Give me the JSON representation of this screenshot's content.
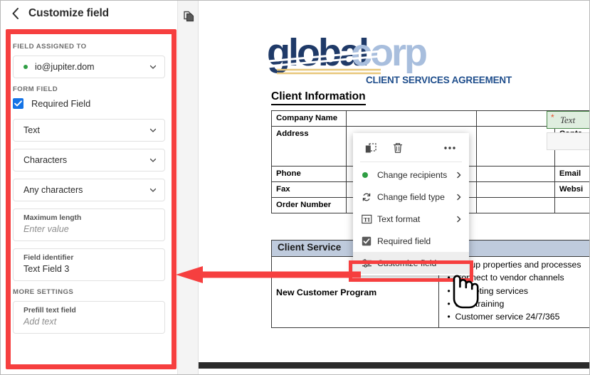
{
  "panel": {
    "title": "Customize field",
    "back_icon": "chevron-left-icon",
    "sections": {
      "assigned_label": "FIELD ASSIGNED TO",
      "assignee": "io@jupiter.dom",
      "assignee_status_color": "#2f9e44",
      "form_field_label": "FORM FIELD",
      "required_checkbox_label": "Required Field",
      "required_checked": true,
      "checkbox_color": "#1473e6",
      "type_select": "Text",
      "unit_select": "Characters",
      "charset_select": "Any characters",
      "max_length_label": "Maximum length",
      "max_length_placeholder": "Enter value",
      "identifier_label": "Field identifier",
      "identifier_value": "Text Field 3",
      "more_settings_label": "MORE SETTINGS",
      "prefill_label": "Prefill text field",
      "prefill_placeholder": "Add text"
    }
  },
  "toolbar": {
    "page_thumbnail_icon": "duplicate-page-icon"
  },
  "document": {
    "logo_text_dark": "global",
    "logo_text_light": "corp",
    "agreement_title": "CLIENT SERVICES AGREEMENT",
    "client_info_heading": "Client Information",
    "client_rows": [
      {
        "label": "Company Name",
        "right_label": ""
      },
      {
        "label": "Address",
        "right_label": "Conta"
      },
      {
        "label": "Phone",
        "right_label": "Email"
      },
      {
        "label": "Fax",
        "right_label": "Websi"
      },
      {
        "label": "Order Number",
        "right_label": ""
      }
    ],
    "active_field": {
      "text": "Text",
      "required_marker": "*",
      "fill_color": "#dfeedf",
      "border_color": "#4a8a4a"
    },
    "services_heading": "Client Service",
    "service_row": {
      "name": "New Customer Program",
      "items": [
        "Set up properties and processes",
        "Connect to vendor channels",
        "Marketing services",
        "Staff training",
        "Customer service 24/7/365"
      ]
    }
  },
  "context_menu": {
    "top_icons": [
      {
        "name": "duplicate-field-icon"
      },
      {
        "name": "delete-field-icon"
      },
      {
        "name": "more-options-icon"
      }
    ],
    "items": [
      {
        "label": "Change recipients",
        "icon": "recipient-dot-icon",
        "has_submenu": true,
        "highlighted": false
      },
      {
        "label": "Change field type",
        "icon": "refresh-icon",
        "has_submenu": true,
        "highlighted": false
      },
      {
        "label": "Text format",
        "icon": "text-format-icon",
        "has_submenu": true,
        "highlighted": false
      },
      {
        "label": "Required field",
        "icon": "checkbox-checked-icon",
        "has_submenu": false,
        "highlighted": false
      },
      {
        "label": "Customize field",
        "icon": "sliders-icon",
        "has_submenu": false,
        "highlighted": true
      }
    ]
  },
  "annotations": {
    "highlight_color": "#f63f3f",
    "arrow_direction": "left"
  }
}
